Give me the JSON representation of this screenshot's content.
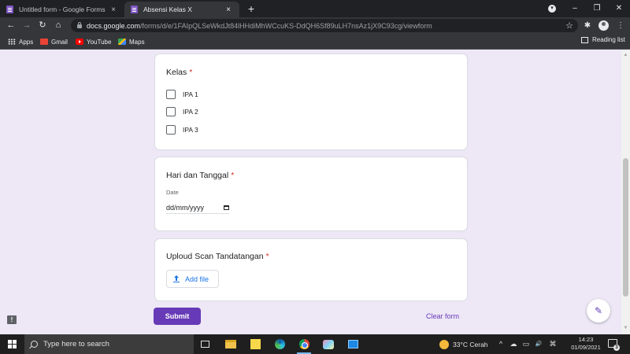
{
  "browser": {
    "tabs": [
      {
        "title": "Untitled form - Google Forms",
        "close": "×"
      },
      {
        "title": "Absensi Kelas X",
        "close": "×"
      }
    ],
    "new_tab": "+",
    "window_controls": {
      "minimize": "–",
      "restore": "❐",
      "close": "✕"
    },
    "url_host": "docs.google.com",
    "url_path": "/forms/d/e/1FAIpQLSeWkdJt84lHHdiMhWCcuKS-DdQH6Sf89uLH7nsAz1jX9C93cg/viewform",
    "nav": {
      "back": "←",
      "forward": "→",
      "reload": "↻",
      "home": "⌂"
    },
    "star": "☆",
    "extensions": "✱",
    "menu": "⋮",
    "bookmarks": [
      {
        "label": "Apps",
        "icon": "apps-grid-icon"
      },
      {
        "label": "Gmail",
        "icon": "gmail-icon"
      },
      {
        "label": "YouTube",
        "icon": "youtube-icon"
      },
      {
        "label": "Maps",
        "icon": "maps-icon"
      }
    ],
    "reading_list": "Reading list"
  },
  "form": {
    "questions": [
      {
        "title": "Kelas",
        "required_mark": "*",
        "type": "checkbox",
        "options": [
          "IPA 1",
          "IPA 2",
          "IPA 3"
        ]
      },
      {
        "title": "Hari dan Tanggal",
        "required_mark": "*",
        "type": "date",
        "field_label": "Date",
        "placeholder": "dd/mm/yyyy"
      },
      {
        "title": "Uploud Scan Tandatangan",
        "required_mark": "*",
        "type": "file",
        "button_label": "Add file"
      }
    ],
    "submit_label": "Submit",
    "clear_label": "Clear form",
    "report_glyph": "!",
    "edit_glyph": "✎"
  },
  "scroll": {
    "up": "▲",
    "down": "▼"
  },
  "taskbar": {
    "search_placeholder": "Type here to search",
    "weather_temp": "33°C",
    "weather_text": "Cerah",
    "time": "14:23",
    "date": "01/09/2021",
    "notification_count": "3",
    "tray_icons": [
      "^",
      "☁",
      "▭",
      "🔊",
      "⌘"
    ]
  },
  "colors": {
    "form_accent": "#673ab7",
    "page_background": "#ede7f6",
    "required": "#d93025",
    "link_blue": "#1a73e8"
  }
}
